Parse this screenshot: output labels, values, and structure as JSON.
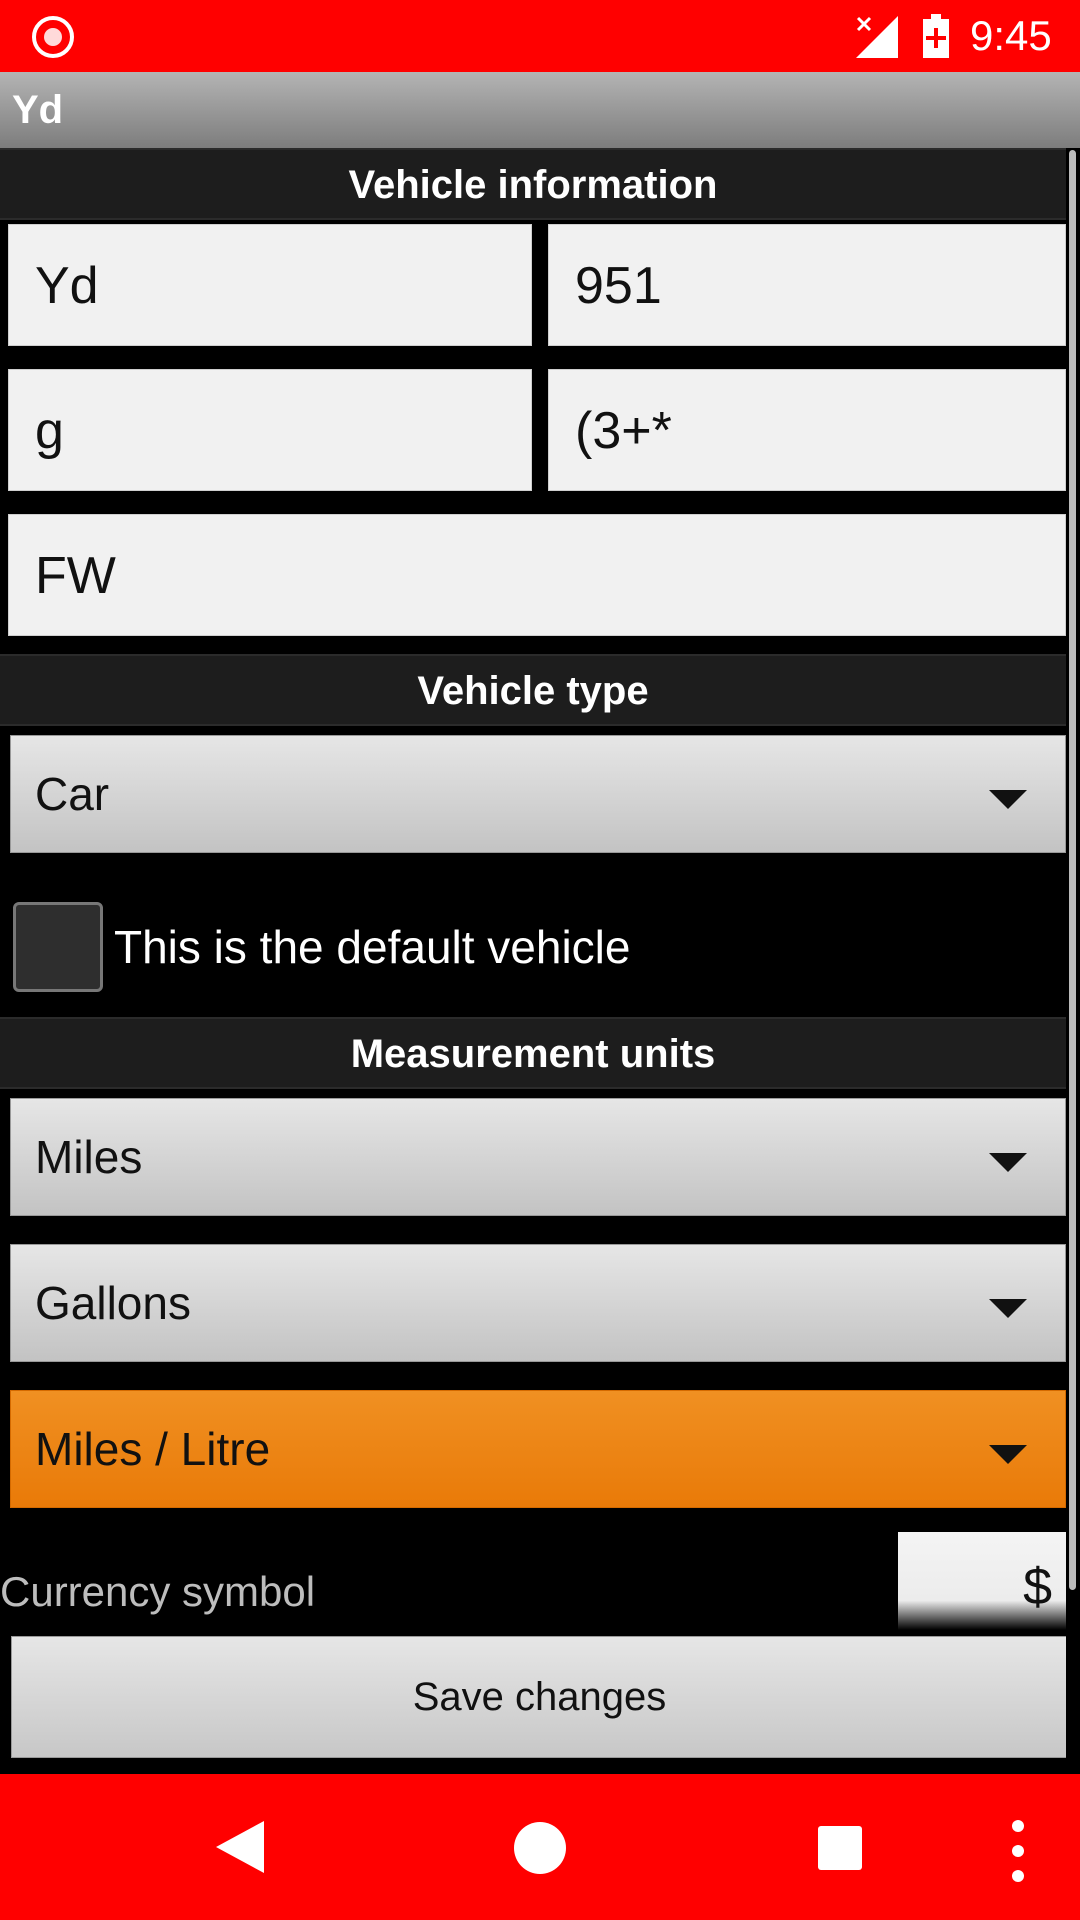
{
  "status_bar": {
    "time": "9:45"
  },
  "app_bar": {
    "title": "Yd"
  },
  "sections": {
    "vehicle_information": "Vehicle information",
    "vehicle_type": "Vehicle type",
    "measurement_units": "Measurement units"
  },
  "fields": {
    "field1": "Yd",
    "field2": "951",
    "field3": "g",
    "field4": "(3+*",
    "field5": "FW"
  },
  "vehicle_type": {
    "selected": "Car"
  },
  "default_vehicle": {
    "label": "This is the default vehicle",
    "checked": false
  },
  "units": {
    "distance": "Miles",
    "volume": "Gallons",
    "consumption": "Miles / Litre"
  },
  "currency": {
    "label": "Currency symbol",
    "value": "$"
  },
  "save_label": "Save changes",
  "colors": {
    "status_bar": "#ff0000",
    "nav_bar": "#ff0000",
    "accent": "#f08418"
  },
  "icons": [
    "record-icon",
    "signal-icon",
    "battery-icon",
    "back-icon",
    "home-icon",
    "recents-icon",
    "overflow-menu-icon",
    "dropdown-caret-icon"
  ]
}
